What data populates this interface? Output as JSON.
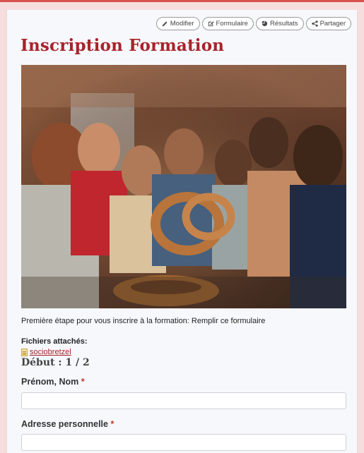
{
  "toolbar": {
    "edit_label": "Modifier",
    "form_label": "Formulaire",
    "results_label": "Résultats",
    "share_label": "Partager"
  },
  "page": {
    "title": "Inscription Formation",
    "intro": "Première étape pour vous inscrire à la formation: Remplir ce formulaire",
    "attachments_label": "Fichiers attachés:",
    "attachment_name": "sociobretzel",
    "step_label": "Début : 1 / 2"
  },
  "fields": [
    {
      "label": "Prénom, Nom",
      "required_mark": "*",
      "value": ""
    },
    {
      "label": "Adresse personnelle",
      "required_mark": "*",
      "value": ""
    }
  ],
  "colors": {
    "accent": "#a8232b",
    "top_border": "#d9534f",
    "background": "#f6dede",
    "panel": "#f7f8fc"
  },
  "icons": [
    "pencil-icon",
    "edit-form-icon",
    "chart-pie-icon",
    "share-icon",
    "file-icon"
  ]
}
